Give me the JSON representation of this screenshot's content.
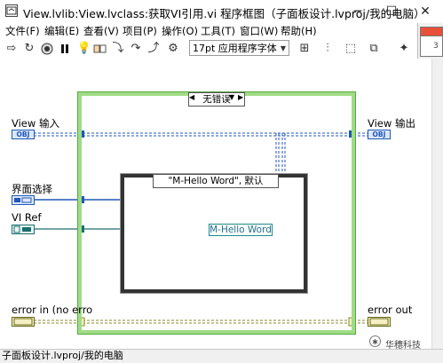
{
  "window": {
    "title": "View.lvlib:View.lvclass:获取VI引用.vi 程序框图（子面板设计.lvproj/我的电脑）",
    "minimize": "─",
    "maximize": "☐",
    "close": "✕"
  },
  "menu": [
    {
      "label": "文件(F)"
    },
    {
      "label": "编辑(E)"
    },
    {
      "label": "查看(V)"
    },
    {
      "label": "项目(P)"
    },
    {
      "label": "操作(O)"
    },
    {
      "label": "工具(T)"
    },
    {
      "label": "窗口(W)"
    },
    {
      "label": "帮助(H)"
    }
  ],
  "toolbar": {
    "font": "17pt 应用程序字体"
  },
  "corner": {
    "number": "3"
  },
  "diagram": {
    "case_selector": "无错误",
    "property_selector": "\"M-Hello Word\", 默认",
    "string_constant": "M-Hello Word",
    "labels": {
      "view_in": "View 输入",
      "view_out": "View 输出",
      "panel_select": "界面选择",
      "vi_ref": "VI Ref",
      "error_in": "error in (no erro",
      "error_out": "error out"
    },
    "terminals": {
      "obj": "OBJ"
    }
  },
  "status_bar": {
    "text": "子面板设计.lvproj/我的电脑"
  },
  "watermark": "华穗科技",
  "colors": {
    "case_border": "#9fdc86",
    "wire_blue": "#2057b8",
    "wire_teal": "#1d6e6e",
    "wire_error": "#8a8a2a",
    "accent_red": "#e8503a"
  }
}
